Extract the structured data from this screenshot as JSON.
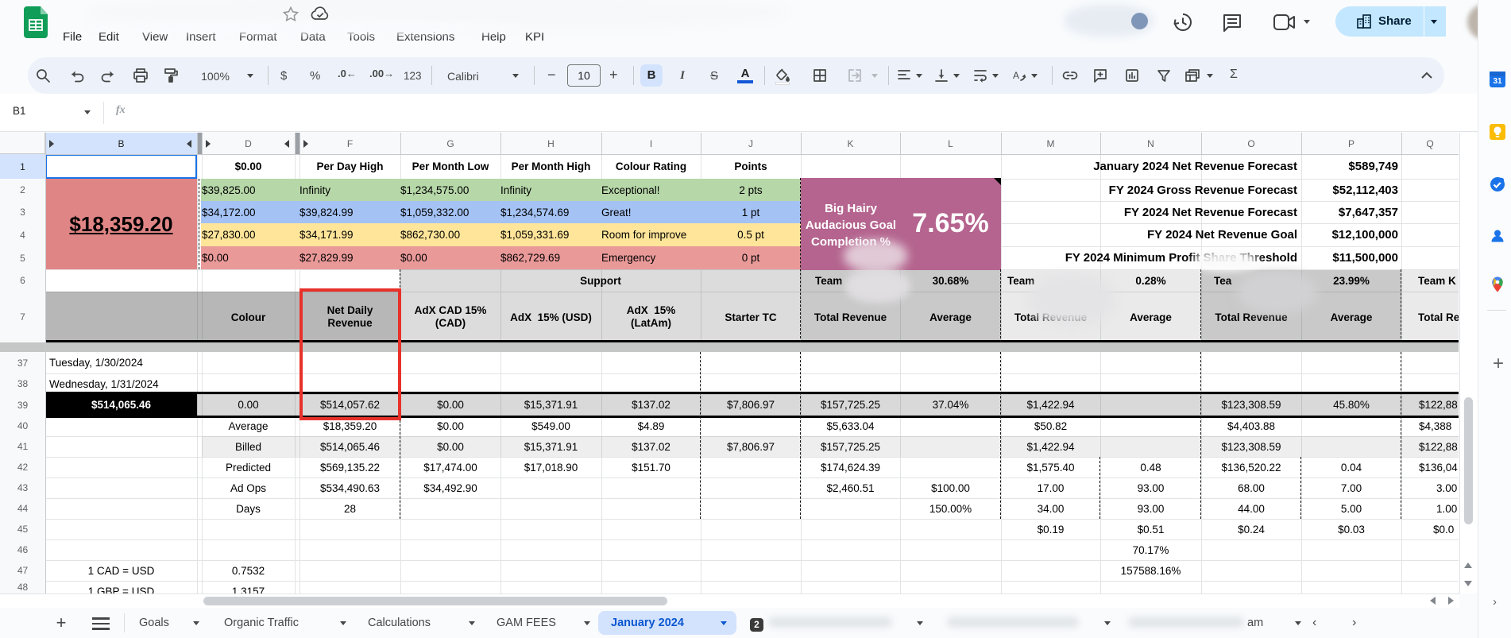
{
  "app": {
    "name": "Google Sheets",
    "menu_items": [
      "File",
      "Edit",
      "View",
      "Insert",
      "Format",
      "Data",
      "Tools",
      "Extensions",
      "Help",
      "KPI"
    ],
    "share_label": "Share"
  },
  "toolbar": {
    "zoom": "100%",
    "currency_label": "$",
    "percent_label": "%",
    "decimal_decrease_label": ".0",
    "decimal_increase_label": ".00",
    "number_format_label": "123",
    "font_name": "Calibri",
    "font_size": "10",
    "bold_label": "B",
    "italic_label": "I",
    "strikethrough_label": "S",
    "text_color_label": "A",
    "functions_label": "Σ"
  },
  "formula_bar": {
    "name_box_value": "B1",
    "fx_label": "fx"
  },
  "colors": {
    "accent_blue": "#1a73e8",
    "toolbar_bg": "#edf2fa",
    "share_bg": "#c2e7ff",
    "share_text": "#001d35",
    "selected_header_bg": "#d3e3fd",
    "active_tab_bg": "#d3e3fd",
    "active_tab_text": "#0b57d0",
    "band_green": "#b6d7a8",
    "band_blue": "#a4c2f4",
    "band_yellow": "#ffe599",
    "band_red": "#ea9999",
    "big_number_bg": "#e08585",
    "goal_box_bg": "#b4648e",
    "header_gray_dark": "#b7b7b7",
    "header_gray_mid": "#dcdcdc",
    "team_gray_dark": "#c9c9c9",
    "team_gray_light": "#eaeaea",
    "total_row_bg": "#d9d9d9",
    "billed_row_bg": "#eeeeee",
    "annotation_red": "#e8312a",
    "sheets_green": "#0f9d58"
  },
  "grid": {
    "column_letters": [
      "B",
      "D",
      "F",
      "G",
      "H",
      "I",
      "J",
      "K",
      "L",
      "M",
      "N",
      "O",
      "P",
      "Q"
    ],
    "row_numbers": [
      "1",
      "2",
      "3",
      "4",
      "5",
      "6",
      "7",
      "37",
      "38",
      "39",
      "40",
      "41",
      "42",
      "43",
      "44",
      "45",
      "46",
      "47",
      "48"
    ],
    "selected_cell": "B1",
    "big_number": "$18,359.20",
    "goal_box": {
      "label_lines": [
        "Big Hairy",
        "Audacious Goal",
        "Completion %"
      ],
      "value": "7.65%"
    },
    "support_header": "Support",
    "forecast_rows": [
      {
        "label": "January 2024 Net Revenue Forecast",
        "value": "$589,749"
      },
      {
        "label": "FY 2024 Gross Revenue Forecast",
        "value": "$52,112,403"
      },
      {
        "label": "FY 2024 Net Revenue Forecast",
        "value": "$7,647,357"
      },
      {
        "label": "FY 2024 Net Revenue Goal",
        "value": "$12,100,000"
      },
      {
        "label": "FY 2024 Minimum Profit Share Threshold",
        "value": "$11,500,000"
      }
    ],
    "cells": [
      {
        "r": "1",
        "c": "D",
        "t": "$0.00",
        "b": 1
      },
      {
        "r": "1",
        "c": "F",
        "t": "Per Day High",
        "b": 1
      },
      {
        "r": "1",
        "c": "G",
        "t": "Per Month Low",
        "b": 1
      },
      {
        "r": "1",
        "c": "H",
        "t": "Per Month High",
        "b": 1
      },
      {
        "r": "1",
        "c": "I",
        "t": "Colour Rating",
        "b": 1
      },
      {
        "r": "1",
        "c": "J",
        "t": "Points",
        "b": 1
      },
      {
        "r": "2",
        "c": "D",
        "t": "$39,825.00",
        "a": "l"
      },
      {
        "r": "2",
        "c": "F",
        "t": "Infinity",
        "a": "l"
      },
      {
        "r": "2",
        "c": "G",
        "t": "$1,234,575.00",
        "a": "l"
      },
      {
        "r": "2",
        "c": "H",
        "t": "Infinity",
        "a": "l"
      },
      {
        "r": "2",
        "c": "I",
        "t": "Exceptional!",
        "a": "l"
      },
      {
        "r": "2",
        "c": "J",
        "t": "2 pts"
      },
      {
        "r": "3",
        "c": "D",
        "t": "$34,172.00",
        "a": "l"
      },
      {
        "r": "3",
        "c": "F",
        "t": "$39,824.99",
        "a": "l"
      },
      {
        "r": "3",
        "c": "G",
        "t": "$1,059,332.00",
        "a": "l"
      },
      {
        "r": "3",
        "c": "H",
        "t": "$1,234,574.69",
        "a": "l"
      },
      {
        "r": "3",
        "c": "I",
        "t": "Great!",
        "a": "l"
      },
      {
        "r": "3",
        "c": "J",
        "t": "1 pt"
      },
      {
        "r": "4",
        "c": "D",
        "t": "$27,830.00",
        "a": "l"
      },
      {
        "r": "4",
        "c": "F",
        "t": "$34,171.99",
        "a": "l"
      },
      {
        "r": "4",
        "c": "G",
        "t": "$862,730.00",
        "a": "l"
      },
      {
        "r": "4",
        "c": "H",
        "t": "$1,059,331.69",
        "a": "l"
      },
      {
        "r": "4",
        "c": "I",
        "t": "Room for improve",
        "a": "l"
      },
      {
        "r": "4",
        "c": "J",
        "t": "0.5 pt"
      },
      {
        "r": "5",
        "c": "D",
        "t": "$0.00",
        "a": "l"
      },
      {
        "r": "5",
        "c": "F",
        "t": "$27,829.99",
        "a": "l"
      },
      {
        "r": "5",
        "c": "G",
        "t": "$0.00",
        "a": "l"
      },
      {
        "r": "5",
        "c": "H",
        "t": "$862,729.69",
        "a": "l"
      },
      {
        "r": "5",
        "c": "I",
        "t": "Emergency",
        "a": "l"
      },
      {
        "r": "5",
        "c": "J",
        "t": "0 pt"
      },
      {
        "r": "6",
        "c": "K",
        "t": "Team",
        "b": 1,
        "a": "l",
        "pl": 18
      },
      {
        "r": "6",
        "c": "L",
        "t": "30.68%",
        "b": 1
      },
      {
        "r": "6",
        "c": "M",
        "t": "Team",
        "b": 1,
        "a": "l",
        "pl": 8
      },
      {
        "r": "6",
        "c": "N",
        "t": "0.28%",
        "b": 1
      },
      {
        "r": "6",
        "c": "O",
        "t": "Tea",
        "b": 1,
        "a": "l",
        "pl": 16
      },
      {
        "r": "6",
        "c": "P",
        "t": "23.99%",
        "b": 1
      },
      {
        "r": "6",
        "c": "Q",
        "t": "Team K",
        "b": 1,
        "a": "l",
        "pl": 21
      },
      {
        "r": "7",
        "c": "D",
        "t": "Colour",
        "b": 1
      },
      {
        "r": "7",
        "c": "F",
        "t": "Net Daily\nRevenue",
        "b": 1
      },
      {
        "r": "7",
        "c": "G",
        "t": "AdX CAD 15%\n(CAD)",
        "b": 1
      },
      {
        "r": "7",
        "c": "H",
        "t": "AdX  15% (USD)",
        "b": 1
      },
      {
        "r": "7",
        "c": "I",
        "t": "AdX  15%\n(LatAm)",
        "b": 1
      },
      {
        "r": "7",
        "c": "J",
        "t": "Starter TC",
        "b": 1
      },
      {
        "r": "7",
        "c": "K",
        "t": "Total Revenue",
        "b": 1
      },
      {
        "r": "7",
        "c": "L",
        "t": "Average",
        "b": 1
      },
      {
        "r": "7",
        "c": "M",
        "t": "Total Revenue",
        "b": 1
      },
      {
        "r": "7",
        "c": "N",
        "t": "Average",
        "b": 1
      },
      {
        "r": "7",
        "c": "O",
        "t": "Total Revenue",
        "b": 1
      },
      {
        "r": "7",
        "c": "P",
        "t": "Average",
        "b": 1
      },
      {
        "r": "7",
        "c": "Q",
        "t": "Total Re",
        "b": 1,
        "a": "l",
        "pl": 21
      },
      {
        "r": "37",
        "c": "B",
        "t": "Tuesday, 1/30/2024",
        "a": "l",
        "pl": 5
      },
      {
        "r": "38",
        "c": "B",
        "t": "Wednesday, 1/31/2024",
        "a": "l",
        "pl": 5
      },
      {
        "r": "39",
        "c": "D",
        "t": "0.00"
      },
      {
        "r": "39",
        "c": "F",
        "t": "$514,057.62"
      },
      {
        "r": "39",
        "c": "G",
        "t": "$0.00"
      },
      {
        "r": "39",
        "c": "H",
        "t": "$15,371.91"
      },
      {
        "r": "39",
        "c": "I",
        "t": "$137.02"
      },
      {
        "r": "39",
        "c": "J",
        "t": "$7,806.97"
      },
      {
        "r": "39",
        "c": "K",
        "t": "$157,725.25"
      },
      {
        "r": "39",
        "c": "L",
        "t": "37.04%"
      },
      {
        "r": "39",
        "c": "M",
        "t": "$1,422.94"
      },
      {
        "r": "39",
        "c": "O",
        "t": "$123,308.59"
      },
      {
        "r": "39",
        "c": "P",
        "t": "45.80%"
      },
      {
        "r": "39",
        "c": "Q",
        "t": "$122,88",
        "a": "l",
        "pl": 22
      },
      {
        "r": "40",
        "c": "D",
        "t": "Average"
      },
      {
        "r": "40",
        "c": "F",
        "t": "$18,359.20"
      },
      {
        "r": "40",
        "c": "G",
        "t": "$0.00"
      },
      {
        "r": "40",
        "c": "H",
        "t": "$549.00"
      },
      {
        "r": "40",
        "c": "I",
        "t": "$4.89"
      },
      {
        "r": "40",
        "c": "K",
        "t": "$5,633.04"
      },
      {
        "r": "40",
        "c": "M",
        "t": "$50.82"
      },
      {
        "r": "40",
        "c": "O",
        "t": "$4,403.88"
      },
      {
        "r": "40",
        "c": "Q",
        "t": "$4,388",
        "a": "l",
        "pl": 22
      },
      {
        "r": "41",
        "c": "D",
        "t": "Billed"
      },
      {
        "r": "41",
        "c": "F",
        "t": "$514,065.46"
      },
      {
        "r": "41",
        "c": "G",
        "t": "$0.00"
      },
      {
        "r": "41",
        "c": "H",
        "t": "$15,371.91"
      },
      {
        "r": "41",
        "c": "I",
        "t": "$137.02"
      },
      {
        "r": "41",
        "c": "J",
        "t": "$7,806.97"
      },
      {
        "r": "41",
        "c": "K",
        "t": "$157,725.25"
      },
      {
        "r": "41",
        "c": "M",
        "t": "$1,422.94"
      },
      {
        "r": "41",
        "c": "O",
        "t": "$123,308.59"
      },
      {
        "r": "41",
        "c": "Q",
        "t": "$122,88",
        "a": "l",
        "pl": 22
      },
      {
        "r": "42",
        "c": "D",
        "t": "Predicted"
      },
      {
        "r": "42",
        "c": "F",
        "t": "$569,135.22"
      },
      {
        "r": "42",
        "c": "G",
        "t": "$17,474.00"
      },
      {
        "r": "42",
        "c": "H",
        "t": "$17,018.90"
      },
      {
        "r": "42",
        "c": "I",
        "t": "$151.70"
      },
      {
        "r": "42",
        "c": "K",
        "t": "$174,624.39"
      },
      {
        "r": "42",
        "c": "M",
        "t": "$1,575.40"
      },
      {
        "r": "42",
        "c": "N",
        "t": "0.48"
      },
      {
        "r": "42",
        "c": "O",
        "t": "$136,520.22"
      },
      {
        "r": "42",
        "c": "P",
        "t": "0.04"
      },
      {
        "r": "42",
        "c": "Q",
        "t": "$136,04",
        "a": "l",
        "pl": 22
      },
      {
        "r": "43",
        "c": "D",
        "t": "Ad Ops"
      },
      {
        "r": "43",
        "c": "F",
        "t": "$534,490.63"
      },
      {
        "r": "43",
        "c": "G",
        "t": "$34,492.90"
      },
      {
        "r": "43",
        "c": "K",
        "t": "$2,460.51"
      },
      {
        "r": "43",
        "c": "L",
        "t": "$100.00"
      },
      {
        "r": "43",
        "c": "M",
        "t": "17.00"
      },
      {
        "r": "43",
        "c": "N",
        "t": "93.00"
      },
      {
        "r": "43",
        "c": "O",
        "t": "68.00"
      },
      {
        "r": "43",
        "c": "P",
        "t": "7.00"
      },
      {
        "r": "43",
        "c": "Q",
        "t": "3.00",
        "a": "l",
        "pl": 44
      },
      {
        "r": "44",
        "c": "D",
        "t": "Days"
      },
      {
        "r": "44",
        "c": "F",
        "t": "28"
      },
      {
        "r": "44",
        "c": "L",
        "t": "150.00%"
      },
      {
        "r": "44",
        "c": "M",
        "t": "34.00"
      },
      {
        "r": "44",
        "c": "N",
        "t": "93.00"
      },
      {
        "r": "44",
        "c": "O",
        "t": "44.00"
      },
      {
        "r": "44",
        "c": "P",
        "t": "5.00"
      },
      {
        "r": "44",
        "c": "Q",
        "t": "1.00",
        "a": "l",
        "pl": 44
      },
      {
        "r": "45",
        "c": "M",
        "t": "$0.19"
      },
      {
        "r": "45",
        "c": "N",
        "t": "$0.51"
      },
      {
        "r": "45",
        "c": "O",
        "t": "$0.24"
      },
      {
        "r": "45",
        "c": "P",
        "t": "$0.03"
      },
      {
        "r": "45",
        "c": "Q",
        "t": "$0.0",
        "a": "l",
        "pl": 40
      },
      {
        "r": "46",
        "c": "N",
        "t": "70.17%"
      },
      {
        "r": "47",
        "c": "B",
        "t": "1 CAD = USD"
      },
      {
        "r": "47",
        "c": "D",
        "t": "0.7532"
      },
      {
        "r": "47",
        "c": "N",
        "t": "157588.16%"
      },
      {
        "r": "48",
        "c": "B",
        "t": "1 GBP = USD"
      },
      {
        "r": "48",
        "c": "D",
        "t": "1.3157"
      }
    ],
    "total_row_header": "$514,065.46"
  },
  "sheet_tabs": {
    "tabs": [
      {
        "label": "Goals"
      },
      {
        "label": "Organic Traffic"
      },
      {
        "label": "Calculations"
      },
      {
        "label": "GAM FEES"
      },
      {
        "label": "January 2024",
        "active": true
      },
      {
        "label": "",
        "badge": "2",
        "redacted": true
      },
      {
        "label": "",
        "redacted": true
      },
      {
        "label": "am",
        "redacted": true
      }
    ]
  }
}
